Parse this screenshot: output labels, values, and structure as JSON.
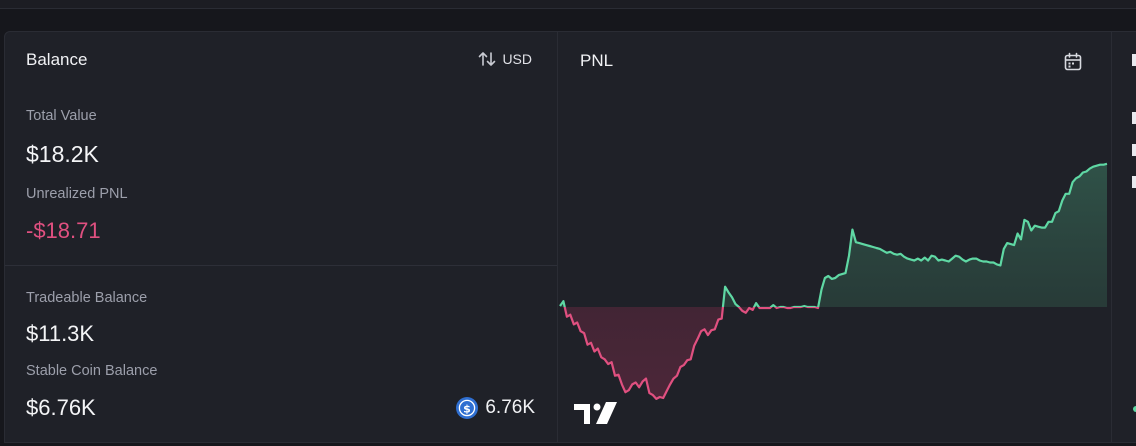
{
  "balance": {
    "title": "Balance",
    "currency_label": "USD",
    "total_value_label": "Total Value",
    "total_value": "$18.2K",
    "unrealized_pnl_label": "Unrealized PNL",
    "unrealized_pnl": "-$18.71",
    "tradeable_balance_label": "Tradeable Balance",
    "tradeable_balance": "$11.3K",
    "stable_coin_label": "Stable Coin Balance",
    "stable_coin_value": "$6.76K",
    "coin_amount": "6.76K",
    "coin_icon": "usdc-coin-icon"
  },
  "pnl": {
    "title": "PNL",
    "calendar_icon": "calendar-icon",
    "logo": "tradingview-logo"
  },
  "colors": {
    "background": "#16171c",
    "panel": "#1f2128",
    "positive": "#5fd8a4",
    "negative": "#e05080",
    "muted_text": "#9c9fab"
  },
  "chart_data": {
    "type": "area",
    "title": "",
    "xlabel": "",
    "ylabel": "",
    "baseline": 0,
    "ylim": [
      -100,
      155
    ],
    "grid": false,
    "values": [
      1,
      6,
      -10,
      -8,
      -18,
      -16,
      -25,
      -27,
      -39,
      -37,
      -46,
      -43,
      -52,
      -54,
      -59,
      -57,
      -71,
      -70,
      -80,
      -88,
      -86,
      -80,
      -78,
      -83,
      -77,
      -74,
      -89,
      -91,
      -95,
      -93,
      -94,
      -87,
      -80,
      -74,
      -71,
      -62,
      -60,
      -55,
      -54,
      -40,
      -33,
      -25,
      -23,
      -29,
      -24,
      -23,
      -13,
      -12,
      21,
      15,
      10,
      3,
      0,
      -4,
      -6,
      -1,
      -3,
      4,
      -1,
      -1,
      -1,
      -1,
      2,
      -1,
      0,
      0,
      -1,
      -1,
      0,
      0,
      0,
      1,
      0,
      0,
      0,
      -1,
      18,
      30,
      32,
      29,
      30,
      33,
      34,
      35,
      53,
      80,
      67,
      66,
      65,
      64,
      63,
      62,
      61,
      60,
      58,
      56,
      57,
      55,
      54,
      55,
      52,
      50,
      49,
      48,
      50,
      48,
      51,
      48,
      53,
      52,
      48,
      49,
      48,
      47,
      50,
      53,
      52,
      49,
      47,
      49,
      50,
      50,
      48,
      47,
      47,
      46,
      46,
      44,
      43,
      60,
      66,
      65,
      64,
      76,
      70,
      90,
      88,
      79,
      84,
      83,
      82,
      82,
      88,
      88,
      97,
      99,
      110,
      117,
      117,
      129,
      133,
      135,
      139,
      140,
      143,
      145,
      146,
      147,
      147,
      148
    ]
  }
}
